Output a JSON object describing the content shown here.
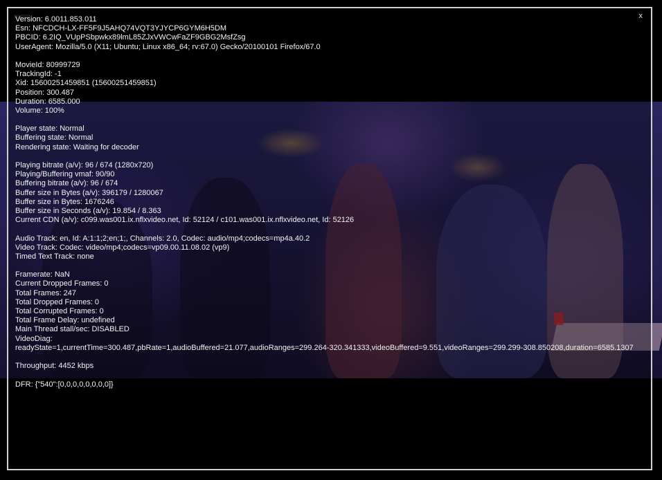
{
  "overlay": {
    "close_label": "x",
    "groups": [
      [
        "Version: 6.0011.853.011",
        "Esn: NFCDCH-LX-FF5F9J5AHQ74VQT3YJYCP6GYM6H5DM",
        "PBCID: 6.2IQ_VUpPSbpwkx89lmL85ZJxVWCwFaZF9GBG2MsfZsg",
        "UserAgent: Mozilla/5.0 (X11; Ubuntu; Linux x86_64; rv:67.0) Gecko/20100101 Firefox/67.0"
      ],
      [
        "MovieId: 80999729",
        "TrackingId: -1",
        "Xid: 15600251459851 (15600251459851)",
        "Position: 300.487",
        "Duration: 6585.000",
        "Volume: 100%"
      ],
      [
        "Player state: Normal",
        "Buffering state: Normal",
        "Rendering state: Waiting for decoder"
      ],
      [
        "Playing bitrate (a/v): 96 / 674 (1280x720)",
        "Playing/Buffering vmaf: 90/90",
        "Buffering bitrate (a/v): 96 / 674",
        "Buffer size in Bytes (a/v): 396179 / 1280067",
        "Buffer size in Bytes: 1676246",
        "Buffer size in Seconds (a/v): 19.854 / 8.363",
        "Current CDN (a/v): c099.was001.ix.nflxvideo.net, Id: 52124 / c101.was001.ix.nflxvideo.net, Id: 52126"
      ],
      [
        "Audio Track: en, Id: A:1:1;2;en;1;, Channels: 2.0, Codec: audio/mp4;codecs=mp4a.40.2",
        "Video Track: Codec: video/mp4;codecs=vp09.00.11.08.02 (vp9)",
        "Timed Text Track: none"
      ],
      [
        "Framerate: NaN",
        "Current Dropped Frames: 0",
        "Total Frames: 247",
        "Total Dropped Frames: 0",
        "Total Corrupted Frames: 0",
        "Total Frame Delay: undefined",
        "Main Thread stall/sec: DISABLED",
        "VideoDiag:",
        "readyState=1,currentTime=300.487,pbRate=1,audioBuffered=21.077,audioRanges=299.264-320.341333,videoBuffered=9.551,videoRanges=299.299-308.850208,duration=6585.1307"
      ],
      [
        "Throughput: 4452 kbps"
      ],
      [
        "DFR: {\"540\":[0,0,0,0,0,0,0,0]}"
      ]
    ]
  }
}
